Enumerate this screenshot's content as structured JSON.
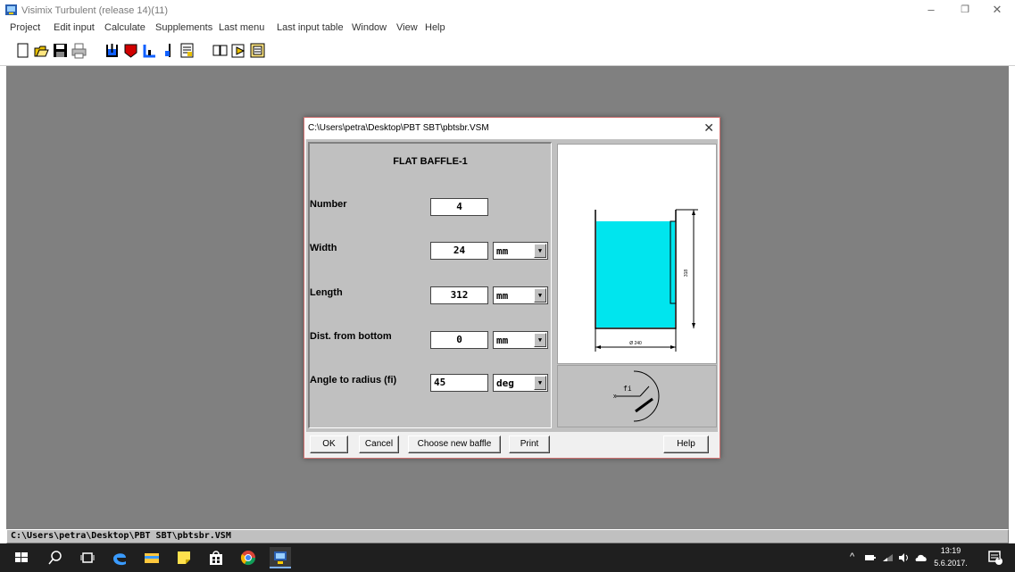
{
  "window": {
    "title": "Visimix Turbulent (release 14)(11)",
    "minimize": "–",
    "maximize": "❐",
    "close": "✕"
  },
  "menu": [
    "Project",
    "Edit input",
    "Calculate",
    "Supplements",
    "Last menu",
    "Last input table",
    "Window",
    "View",
    "Help"
  ],
  "toolbar": {
    "buttons": [
      "new-icon",
      "open-icon",
      "save-icon",
      "print-icon",
      "vessel-icon",
      "baffle-icon",
      "heat-transfer-icon",
      "impeller-icon",
      "table-icon",
      "book-icon",
      "calculate-icon",
      "report-icon"
    ]
  },
  "status": {
    "path": "C:\\Users\\petra\\Desktop\\PBT SBT\\pbtsbr.VSM"
  },
  "dialog": {
    "title": "C:\\Users\\petra\\Desktop\\PBT SBT\\pbtsbr.VSM",
    "close": "✕",
    "heading": "FLAT BAFFLE-1",
    "fields": {
      "number": {
        "label": "Number",
        "value": "4"
      },
      "width": {
        "label": "Width",
        "value": "24",
        "unit": "mm"
      },
      "length": {
        "label": "Length",
        "value": "312",
        "unit": "mm"
      },
      "dist": {
        "label": "Dist. from bottom",
        "value": "0",
        "unit": "mm"
      },
      "angle": {
        "label": "Angle to radius (fi)",
        "value": "45",
        "unit": "deg"
      }
    },
    "diagram": {
      "liquid_color": "#00e5ee",
      "height_label": "318",
      "diameter_label": "Ø 240",
      "angle_label": "fi"
    },
    "buttons": {
      "ok": "OK",
      "cancel": "Cancel",
      "choose": "Choose new baffle",
      "print": "Print",
      "help": "Help"
    }
  },
  "tray": {
    "time": "13:19",
    "date": "5.6.2017.",
    "notification_count": "1"
  }
}
